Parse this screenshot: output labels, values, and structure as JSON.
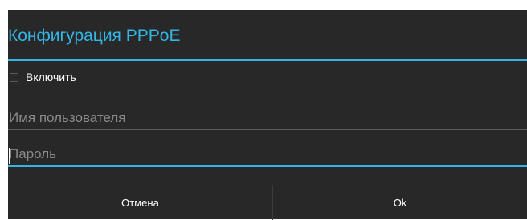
{
  "dialog": {
    "title": "Конфигурация PPPoE",
    "enable_checkbox": {
      "label": "Включить",
      "checked": false
    },
    "username_field": {
      "value": "",
      "placeholder": "Имя пользователя"
    },
    "password_field": {
      "value": "",
      "placeholder": "Пароль"
    },
    "buttons": {
      "cancel": "Отмена",
      "ok": "Ok"
    }
  },
  "colors": {
    "accent": "#33b5e5",
    "background": "#282828"
  }
}
